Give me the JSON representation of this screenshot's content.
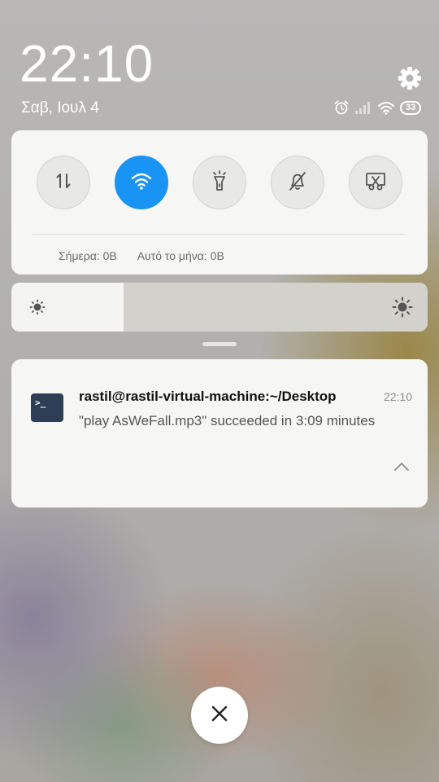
{
  "status": {
    "time": "22:10",
    "date": "Σαβ, Ιουλ 4",
    "battery": "33",
    "icons": [
      "alarm-icon",
      "cell-signal-icon",
      "wifi-icon",
      "battery-icon"
    ]
  },
  "quick_settings": {
    "toggles": [
      {
        "name": "mobile-data",
        "icon": "data-arrows-icon",
        "active": false
      },
      {
        "name": "wifi",
        "icon": "wifi-icon",
        "active": true
      },
      {
        "name": "flashlight",
        "icon": "flashlight-icon",
        "active": false
      },
      {
        "name": "silent",
        "icon": "bell-off-icon",
        "active": false
      },
      {
        "name": "screenshot",
        "icon": "scissors-icon",
        "active": false
      }
    ],
    "data_today": "Σήμερα: 0B",
    "data_month": "Αυτό το μήνα: 0B"
  },
  "brightness": {
    "level": 0.27
  },
  "notification": {
    "title": "rastil@rastil-virtual-machine:~/Desktop",
    "time": "22:10",
    "body": "\"play AsWeFall.mp3\" succeeded in 3:09 minutes",
    "icon_text": ">_"
  },
  "colors": {
    "accent": "#1994f5",
    "card_bg": "#f6f6f5",
    "terminal_icon_bg": "#2d3e55"
  }
}
